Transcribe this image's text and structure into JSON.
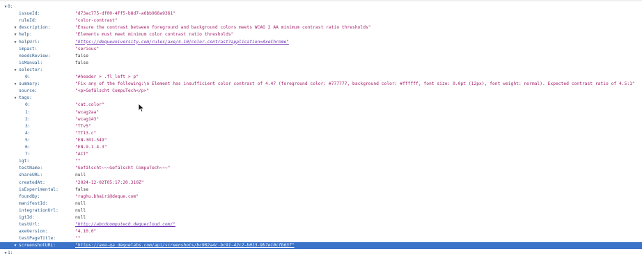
{
  "viewer": {
    "rows": [
      {
        "key": "0:",
        "indent": 0,
        "toggle": "expanded"
      },
      {
        "key": "issueId:",
        "indent": 2,
        "value": "\"d73ac775-df00-4ff5-b8d7-a6bb968a9361\"",
        "vtype": "str"
      },
      {
        "key": "ruleId:",
        "indent": 2,
        "value": "\"color-contrast\"",
        "vtype": "str"
      },
      {
        "key": "description:",
        "indent": 1,
        "toggle": "expanded",
        "value": "\"Ensure the contrast between foreground and background colors meets WCAG 2 AA minimum contrast ratio thresholds\"",
        "vtype": "str"
      },
      {
        "key": "help:",
        "indent": 1,
        "toggle": "expanded",
        "value": "\"Elements must meet minimum color contrast ratio thresholds\"",
        "vtype": "str"
      },
      {
        "key": "helpUrl:",
        "indent": 1,
        "toggle": "expanded",
        "value": "\"https://dequeuniversity.com/rules/axe/4.10/color-contrast?application=AxeChrome\"",
        "vtype": "link"
      },
      {
        "key": "impact:",
        "indent": 2,
        "value": "\"serious\"",
        "vtype": "str"
      },
      {
        "key": "needsReview:",
        "indent": 2,
        "value": "false",
        "vtype": "bool"
      },
      {
        "key": "isManual:",
        "indent": 2,
        "value": "false",
        "vtype": "bool"
      },
      {
        "key": "selector:",
        "indent": 1,
        "toggle": "expanded"
      },
      {
        "key": "0:",
        "indent": 3,
        "value": "\"#header > .fl_left > p\"",
        "vtype": "str"
      },
      {
        "key": "summary:",
        "indent": 1,
        "toggle": "expanded",
        "value": "\"Fix any of the following:\\n  Element has insufficient color contrast of 4.47 (foreground color: #777777, background color: #ffffff, font size: 9.0pt (12px), font weight: normal). Expected contrast ratio of 4.5:1\"",
        "vtype": "str"
      },
      {
        "key": "source:",
        "indent": 2,
        "value": "\"<p>Gefälscht CompuTech</p>\"",
        "vtype": "str"
      },
      {
        "key": "tags:",
        "indent": 1,
        "toggle": "expanded"
      },
      {
        "key": "0:",
        "indent": 3,
        "value": "\"cat.color\"",
        "vtype": "str"
      },
      {
        "key": "1:",
        "indent": 3,
        "value": "\"wcag2aa\"",
        "vtype": "str"
      },
      {
        "key": "2:",
        "indent": 3,
        "value": "\"wcag143\"",
        "vtype": "str"
      },
      {
        "key": "3:",
        "indent": 3,
        "value": "\"TTv5\"",
        "vtype": "str"
      },
      {
        "key": "4:",
        "indent": 3,
        "value": "\"TT13.c\"",
        "vtype": "str"
      },
      {
        "key": "5:",
        "indent": 3,
        "value": "\"EN-301-549\"",
        "vtype": "str"
      },
      {
        "key": "6:",
        "indent": 3,
        "value": "\"EN-9.1.4.3\"",
        "vtype": "str"
      },
      {
        "key": "7:",
        "indent": 3,
        "value": "\"ACT\"",
        "vtype": "str"
      },
      {
        "key": "igt:",
        "indent": 2,
        "value": "\"\"",
        "vtype": "str"
      },
      {
        "key": "testName:",
        "indent": 2,
        "value": "\"Gefälscht~~~Gefälscht CompuTech~~~\"",
        "vtype": "str"
      },
      {
        "key": "shareURL:",
        "indent": 2,
        "value": "null",
        "vtype": "lit"
      },
      {
        "key": "createdAt:",
        "indent": 2,
        "value": "\"2024-12-02T05:17:20.310Z\"",
        "vtype": "str"
      },
      {
        "key": "isExperimental:",
        "indent": 2,
        "value": "false",
        "vtype": "bool"
      },
      {
        "key": "foundBy:",
        "indent": 2,
        "value": "\"raghu.bhairi@deque.com\"",
        "vtype": "str"
      },
      {
        "key": "manifestId:",
        "indent": 2,
        "value": "null",
        "vtype": "lit"
      },
      {
        "key": "integrationUrl:",
        "indent": 2,
        "value": "null",
        "vtype": "lit"
      },
      {
        "key": "igtId:",
        "indent": 2,
        "value": "null",
        "vtype": "lit"
      },
      {
        "key": "testUrl:",
        "indent": 2,
        "value": "\"http://abcdcomputech.dequecloud.com/\"",
        "vtype": "link"
      },
      {
        "key": "axeVersion:",
        "indent": 2,
        "value": "\"4.10.0\"",
        "vtype": "str"
      },
      {
        "key": "testPageTitle:",
        "indent": 2,
        "value": "\"\"",
        "vtype": "str"
      },
      {
        "key": "screenshotURL:",
        "indent": 1,
        "toggle": "expanded",
        "selected": true,
        "value": "\"https://axe-qa.dequelabs.com/api/screenshots/bc902a4c-bc91-42c2-b013-9b7e10cfb63f\"",
        "vtype": "link"
      },
      {
        "key": "1:",
        "indent": 0,
        "toggle": "expanded"
      }
    ],
    "toggle_glyph": "▼"
  }
}
